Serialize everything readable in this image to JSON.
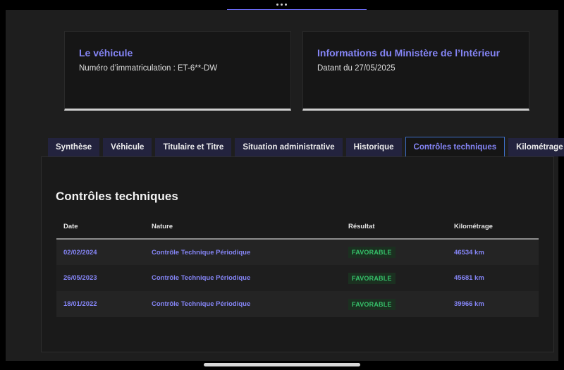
{
  "card_vehicle": {
    "title": "Le véhicule",
    "text": "Numéro d’immatriculation : ET-6**-DW"
  },
  "card_ministry": {
    "title": "Informations du Ministère de l’Intérieur",
    "text": "Datant du 27/05/2025"
  },
  "tabs": [
    {
      "label": "Synthèse",
      "active": false
    },
    {
      "label": "Véhicule",
      "active": false
    },
    {
      "label": "Titulaire et Titre",
      "active": false
    },
    {
      "label": "Situation administrative",
      "active": false
    },
    {
      "label": "Historique",
      "active": false
    },
    {
      "label": "Contrôles techniques",
      "active": true
    },
    {
      "label": "Kilométrage",
      "active": false
    }
  ],
  "section": {
    "title": "Contrôles techniques",
    "columns": [
      "Date",
      "Nature",
      "Résultat",
      "Kilométrage"
    ],
    "rows": [
      {
        "date": "02/02/2024",
        "nature": "Contrôle Technique Périodique",
        "result": "FAVORABLE",
        "km": "46534 km"
      },
      {
        "date": "26/05/2023",
        "nature": "Contrôle Technique Périodique",
        "result": "FAVORABLE",
        "km": "45681 km"
      },
      {
        "date": "18/01/2022",
        "nature": "Contrôle Technique Périodique",
        "result": "FAVORABLE",
        "km": "39966 km"
      }
    ]
  },
  "colors": {
    "accent": "#8585f6",
    "tab_bg": "#23233e",
    "badge_bg": "#1b3020",
    "badge_text": "#36c16a",
    "active_border": "#3d6ec6"
  }
}
